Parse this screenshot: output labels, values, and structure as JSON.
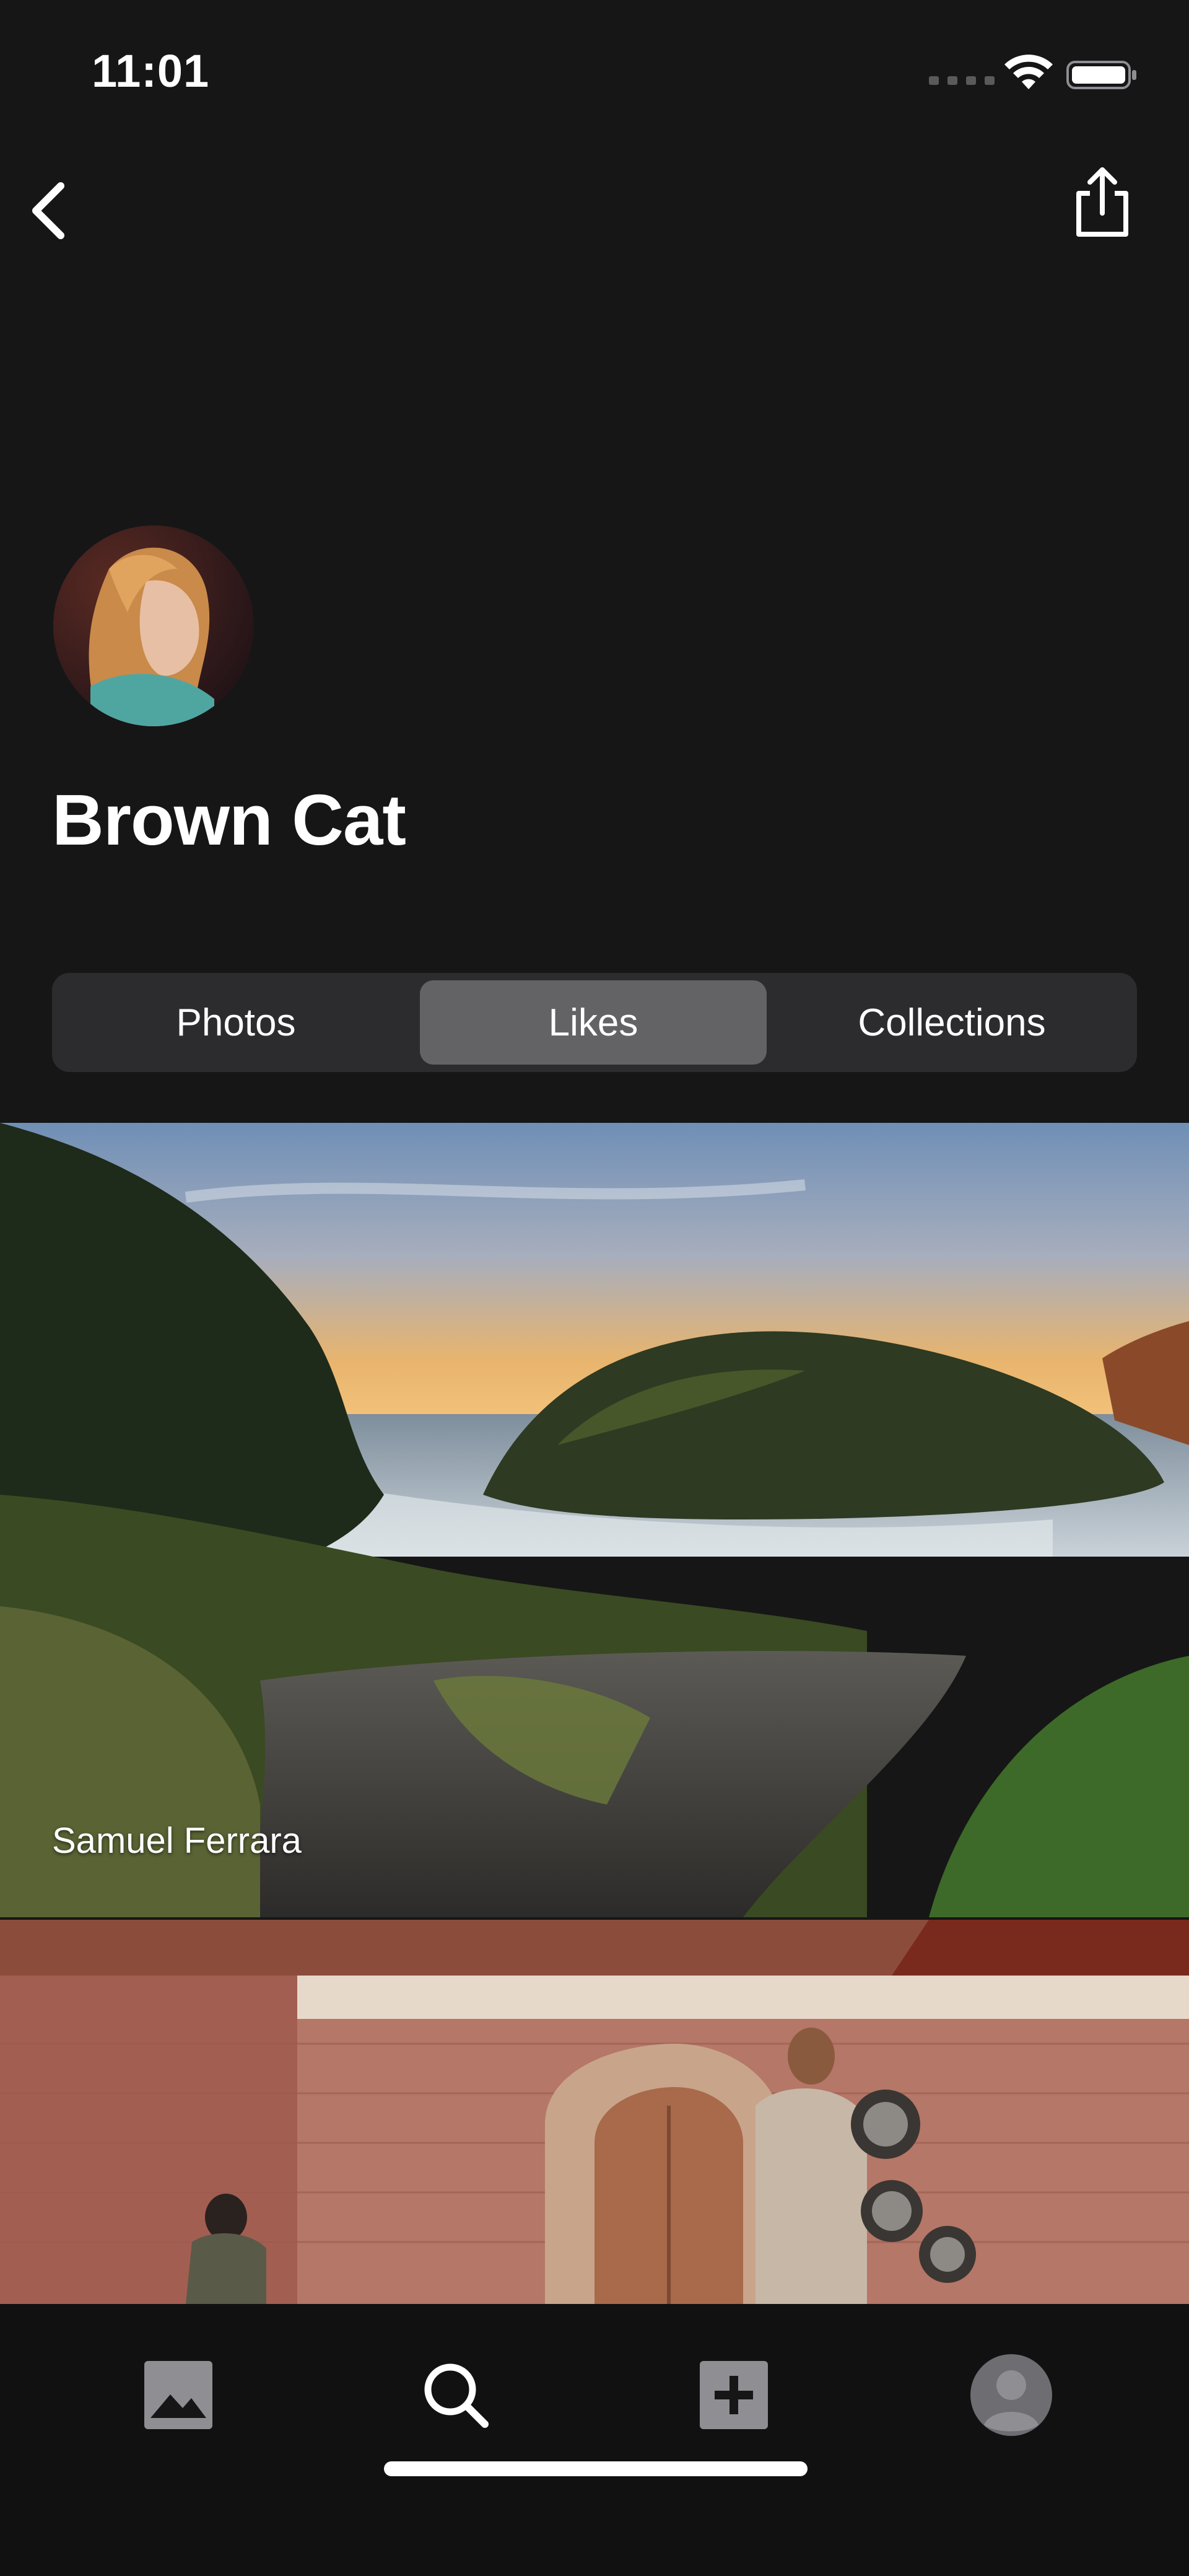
{
  "status_bar": {
    "time": "11:01"
  },
  "header": {
    "back_icon": "chevron-left-icon",
    "share_icon": "share-icon"
  },
  "profile": {
    "name": "Brown Cat",
    "avatar_icon": "avatar"
  },
  "segments": {
    "items": [
      {
        "label": "Photos"
      },
      {
        "label": "Likes"
      },
      {
        "label": "Collections"
      }
    ],
    "selected": "Likes"
  },
  "feed": {
    "items": [
      {
        "author": "Samuel Ferrara"
      },
      {
        "author": ""
      }
    ]
  },
  "tab_bar": {
    "items": [
      {
        "icon": "photo-icon"
      },
      {
        "icon": "search-icon"
      },
      {
        "icon": "add-icon"
      },
      {
        "icon": "profile-icon"
      }
    ]
  },
  "colors": {
    "background": "#161617",
    "segment_bg": "#2c2c2e",
    "segment_selected": "#636366",
    "tabbar_bg": "#111111"
  }
}
